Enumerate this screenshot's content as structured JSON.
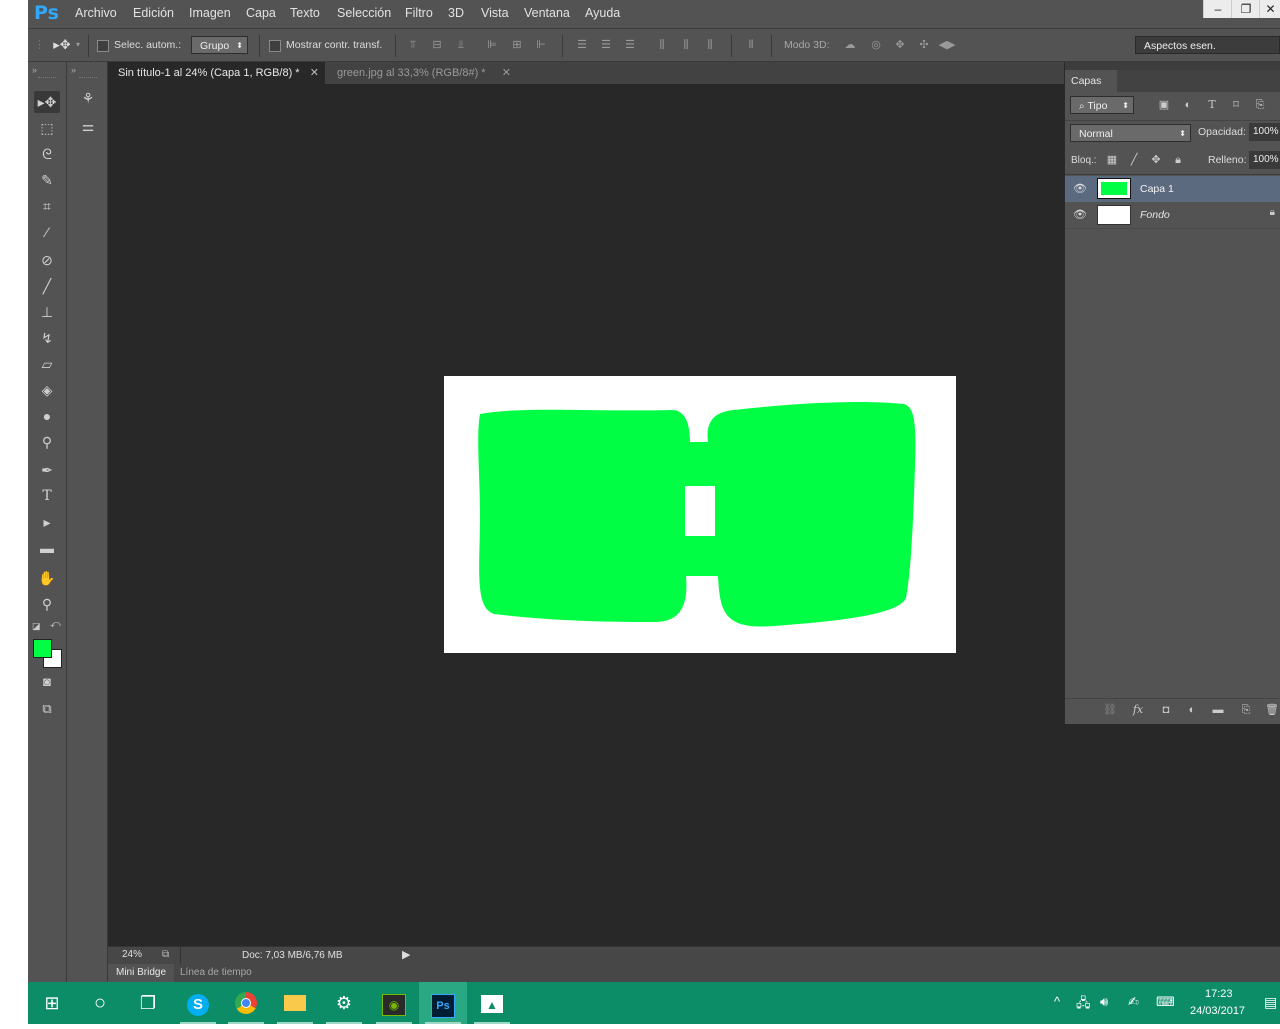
{
  "app": {
    "logo": "Ps"
  },
  "menu": [
    "Archivo",
    "Edición",
    "Imagen",
    "Capa",
    "Texto",
    "Selección",
    "Filtro",
    "3D",
    "Vista",
    "Ventana",
    "Ayuda"
  ],
  "options": {
    "auto_select_label": "Selec. autom.:",
    "auto_select_value": "Grupo",
    "show_transform_label": "Mostrar contr. transf.",
    "mode3d_label": "Modo 3D:",
    "workspace": "Aspectos esen."
  },
  "tabs": [
    {
      "label": "Sin título-1 al 24% (Capa 1, RGB/8) *",
      "active": true
    },
    {
      "label": "green.jpg al 33,3% (RGB/8#) *",
      "active": false
    }
  ],
  "layers_panel": {
    "title": "Capas",
    "filter_value": "Tipo",
    "blend_mode": "Normal",
    "opacity_label": "Opacidad:",
    "opacity_value": "100%",
    "lock_label": "Bloq.:",
    "fill_label": "Relleno:",
    "fill_value": "100%",
    "layers": [
      {
        "name": "Capa 1",
        "selected": true
      },
      {
        "name": "Fondo",
        "selected": false
      }
    ]
  },
  "status": {
    "zoom": "24%",
    "doc": "Doc: 7,03 MB/6,76 MB"
  },
  "bottom_tabs": [
    "Mini Bridge",
    "Línea de tiempo"
  ],
  "taskbar": {
    "time": "17:23",
    "date": "24/03/2017"
  },
  "colors": {
    "foreground": "#00ff44",
    "background": "#ffffff",
    "accent": "#31a8ff",
    "taskbar": "#0c8c67"
  }
}
